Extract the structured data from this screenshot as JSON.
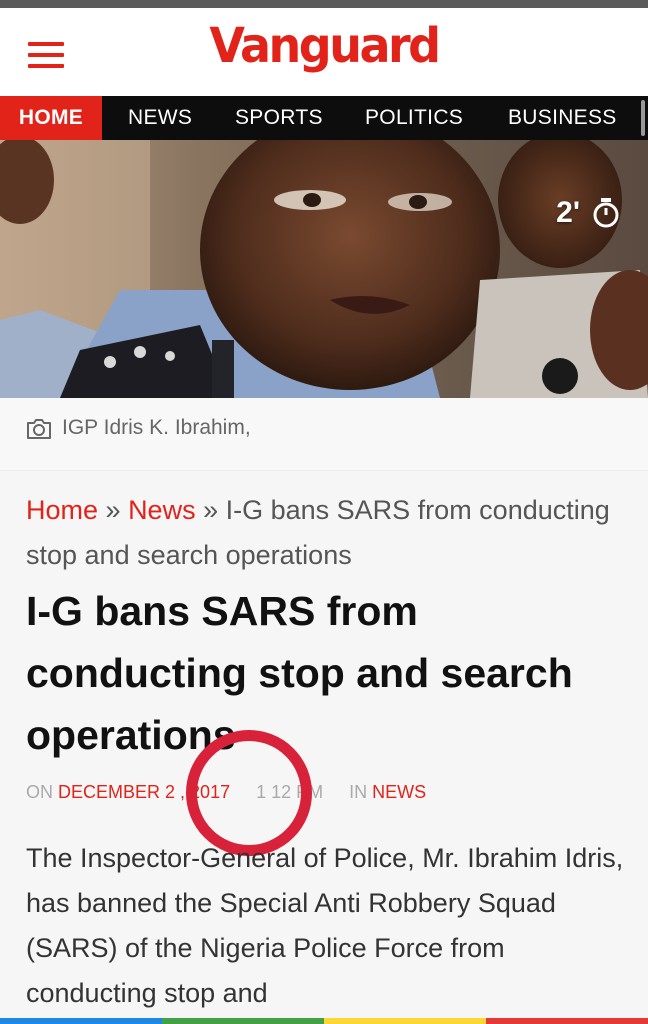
{
  "header": {
    "logo_text": "Vanguard",
    "brand_color": "#e2231a"
  },
  "nav": {
    "items": [
      {
        "label": "HOME",
        "active": true
      },
      {
        "label": "NEWS",
        "active": false
      },
      {
        "label": "SPORTS",
        "active": false
      },
      {
        "label": "POLITICS",
        "active": false
      },
      {
        "label": "BUSINESS",
        "active": false
      }
    ]
  },
  "hero": {
    "read_time": "2'",
    "timer_icon": "stopwatch-icon",
    "caption_icon": "camera-icon",
    "caption": "IGP Idris K. Ibrahim,"
  },
  "breadcrumb": {
    "home": "Home",
    "sep1": " » ",
    "news": "News",
    "sep2": " » ",
    "current": "I-G bans SARS from conducting stop and search operations"
  },
  "article": {
    "title": "I-G bans SARS from conducting stop and search operations",
    "meta": {
      "on_label": "ON",
      "date": "DECEMBER 2 , 2017",
      "time": "1 12 PM",
      "in_label": "IN",
      "category": "NEWS"
    },
    "body": "The Inspector-General of Police, Mr. Ibrahim Idris, has banned the Special Anti Robbery Squad (SARS) of the Nigeria Police Force from conducting stop and"
  },
  "annotation": {
    "color": "#d8223a"
  }
}
